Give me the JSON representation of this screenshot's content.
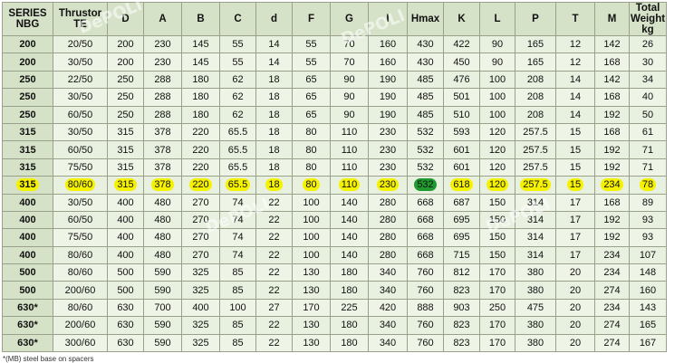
{
  "columns": [
    "SERIES NBG",
    "Thrustor TE",
    "D",
    "A",
    "B",
    "C",
    "d",
    "F",
    "G",
    "I",
    "Hmax",
    "K",
    "L",
    "P",
    "T",
    "M",
    "Total Weight kg"
  ],
  "rows": [
    [
      "200",
      "20/50",
      "200",
      "230",
      "145",
      "55",
      "14",
      "55",
      "70",
      "160",
      "430",
      "422",
      "90",
      "165",
      "12",
      "142",
      "26"
    ],
    [
      "200",
      "30/50",
      "200",
      "230",
      "145",
      "55",
      "14",
      "55",
      "70",
      "160",
      "430",
      "450",
      "90",
      "165",
      "12",
      "168",
      "30"
    ],
    [
      "250",
      "22/50",
      "250",
      "288",
      "180",
      "62",
      "18",
      "65",
      "90",
      "190",
      "485",
      "476",
      "100",
      "208",
      "14",
      "142",
      "34"
    ],
    [
      "250",
      "30/50",
      "250",
      "288",
      "180",
      "62",
      "18",
      "65",
      "90",
      "190",
      "485",
      "501",
      "100",
      "208",
      "14",
      "168",
      "40"
    ],
    [
      "250",
      "60/50",
      "250",
      "288",
      "180",
      "62",
      "18",
      "65",
      "90",
      "190",
      "485",
      "510",
      "100",
      "208",
      "14",
      "192",
      "50"
    ],
    [
      "315",
      "30/50",
      "315",
      "378",
      "220",
      "65.5",
      "18",
      "80",
      "110",
      "230",
      "532",
      "593",
      "120",
      "257.5",
      "15",
      "168",
      "61"
    ],
    [
      "315",
      "60/50",
      "315",
      "378",
      "220",
      "65.5",
      "18",
      "80",
      "110",
      "230",
      "532",
      "601",
      "120",
      "257.5",
      "15",
      "192",
      "71"
    ],
    [
      "315",
      "75/50",
      "315",
      "378",
      "220",
      "65.5",
      "18",
      "80",
      "110",
      "230",
      "532",
      "601",
      "120",
      "257.5",
      "15",
      "192",
      "71"
    ],
    [
      "315",
      "80/60",
      "315",
      "378",
      "220",
      "65.5",
      "18",
      "80",
      "110",
      "230",
      "532",
      "618",
      "120",
      "257.5",
      "15",
      "234",
      "78"
    ],
    [
      "400",
      "30/50",
      "400",
      "480",
      "270",
      "74",
      "22",
      "100",
      "140",
      "280",
      "668",
      "687",
      "150",
      "314",
      "17",
      "168",
      "89"
    ],
    [
      "400",
      "60/50",
      "400",
      "480",
      "270",
      "74",
      "22",
      "100",
      "140",
      "280",
      "668",
      "695",
      "150",
      "314",
      "17",
      "192",
      "93"
    ],
    [
      "400",
      "75/50",
      "400",
      "480",
      "270",
      "74",
      "22",
      "100",
      "140",
      "280",
      "668",
      "695",
      "150",
      "314",
      "17",
      "192",
      "93"
    ],
    [
      "400",
      "80/60",
      "400",
      "480",
      "270",
      "74",
      "22",
      "100",
      "140",
      "280",
      "668",
      "715",
      "150",
      "314",
      "17",
      "234",
      "107"
    ],
    [
      "500",
      "80/60",
      "500",
      "590",
      "325",
      "85",
      "22",
      "130",
      "180",
      "340",
      "760",
      "812",
      "170",
      "380",
      "20",
      "234",
      "148"
    ],
    [
      "500",
      "200/60",
      "500",
      "590",
      "325",
      "85",
      "22",
      "130",
      "180",
      "340",
      "760",
      "823",
      "170",
      "380",
      "20",
      "274",
      "160"
    ],
    [
      "630*",
      "80/60",
      "630",
      "700",
      "400",
      "100",
      "27",
      "170",
      "225",
      "420",
      "888",
      "903",
      "250",
      "475",
      "20",
      "234",
      "143"
    ],
    [
      "630*",
      "200/60",
      "630",
      "590",
      "325",
      "85",
      "22",
      "130",
      "180",
      "340",
      "760",
      "823",
      "170",
      "380",
      "20",
      "274",
      "165"
    ],
    [
      "630*",
      "300/60",
      "630",
      "590",
      "325",
      "85",
      "22",
      "130",
      "180",
      "340",
      "760",
      "823",
      "170",
      "380",
      "20",
      "274",
      "167"
    ]
  ],
  "highlight_row_index": 8,
  "highlight_color": "#f5f200",
  "highlight_accent_column": 10,
  "highlight_accent_color": "#1e9a2e",
  "footnote": "*(MB) steel base on spacers",
  "watermark": "DePOLI"
}
